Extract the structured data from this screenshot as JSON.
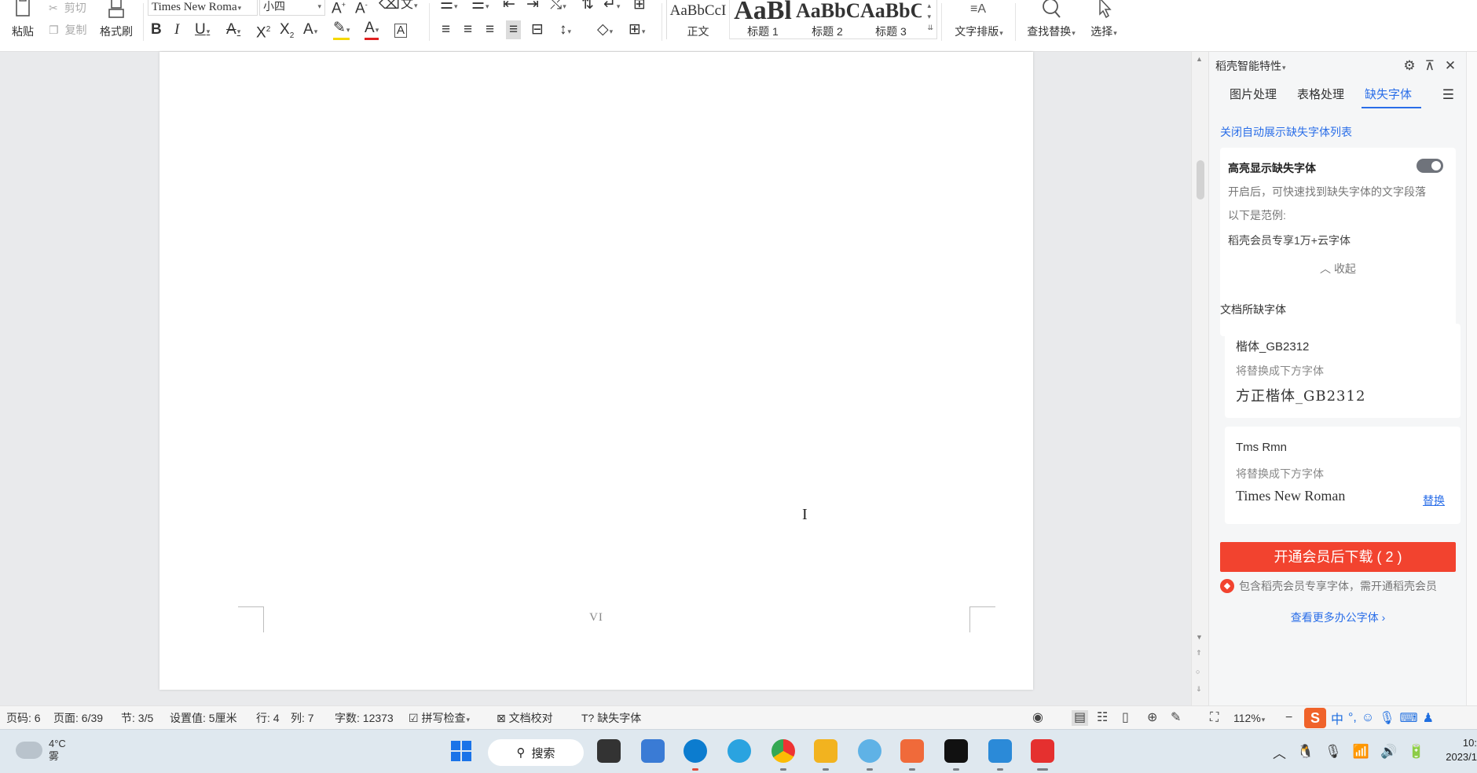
{
  "ribbon": {
    "paste_label": "粘贴",
    "cut_label": "剪切",
    "copy_label": "复制",
    "format_painter_label": "格式刷",
    "font_name": "Times New Roma",
    "font_size": "小四",
    "styles": [
      {
        "preview": "AaBbCcI",
        "name": "正文"
      },
      {
        "preview": "AaBl",
        "name": "标题 1"
      },
      {
        "preview": "AaBbC",
        "name": "标题 2"
      },
      {
        "preview": "AaBbC",
        "name": "标题 3"
      }
    ],
    "text_layout_label": "文字排版",
    "find_replace_label": "查找替换",
    "select_label": "选择"
  },
  "document": {
    "page_number_text": "VI"
  },
  "panel": {
    "title": "稻壳智能特性",
    "tabs": [
      "图片处理",
      "表格处理",
      "缺失字体"
    ],
    "active_tab": "缺失字体",
    "close_auto_link": "关闭自动展示缺失字体列表",
    "highlight_title": "高亮显示缺失字体",
    "highlight_desc": "开启后，可快速找到缺失字体的文字段落",
    "example_label": "以下是范例:",
    "example_text": "稻壳会员专享1万+云字体",
    "collapse_label": "收起",
    "missing_section": "文档所缺字体",
    "missing_fonts": [
      {
        "name": "楷体_GB2312",
        "sub": "将替换成下方字体",
        "replacement": "方正楷体_GB2312",
        "action": ""
      },
      {
        "name": "Tms Rmn",
        "sub": "将替换成下方字体",
        "replacement": "Times New Roman",
        "action": "替换"
      }
    ],
    "cta_label": "开通会员后下载 ( 2 )",
    "note": "包含稻壳会员专享字体，需开通稻壳会员",
    "more_link": "查看更多办公字体"
  },
  "status": {
    "page_code": "页码: 6",
    "page": "页面: 6/39",
    "section": "节: 3/5",
    "setting": "设置值: 5厘米",
    "row": "行: 4",
    "col": "列: 7",
    "word_count": "字数: 12373",
    "spell_check": "拼写检查",
    "proofread": "文档校对",
    "missing_font": "缺失字体",
    "zoom": "112%"
  },
  "taskbar": {
    "temp": "4°C",
    "weather": "雾",
    "search": "搜索",
    "time": "10:",
    "date": "2023/1"
  }
}
